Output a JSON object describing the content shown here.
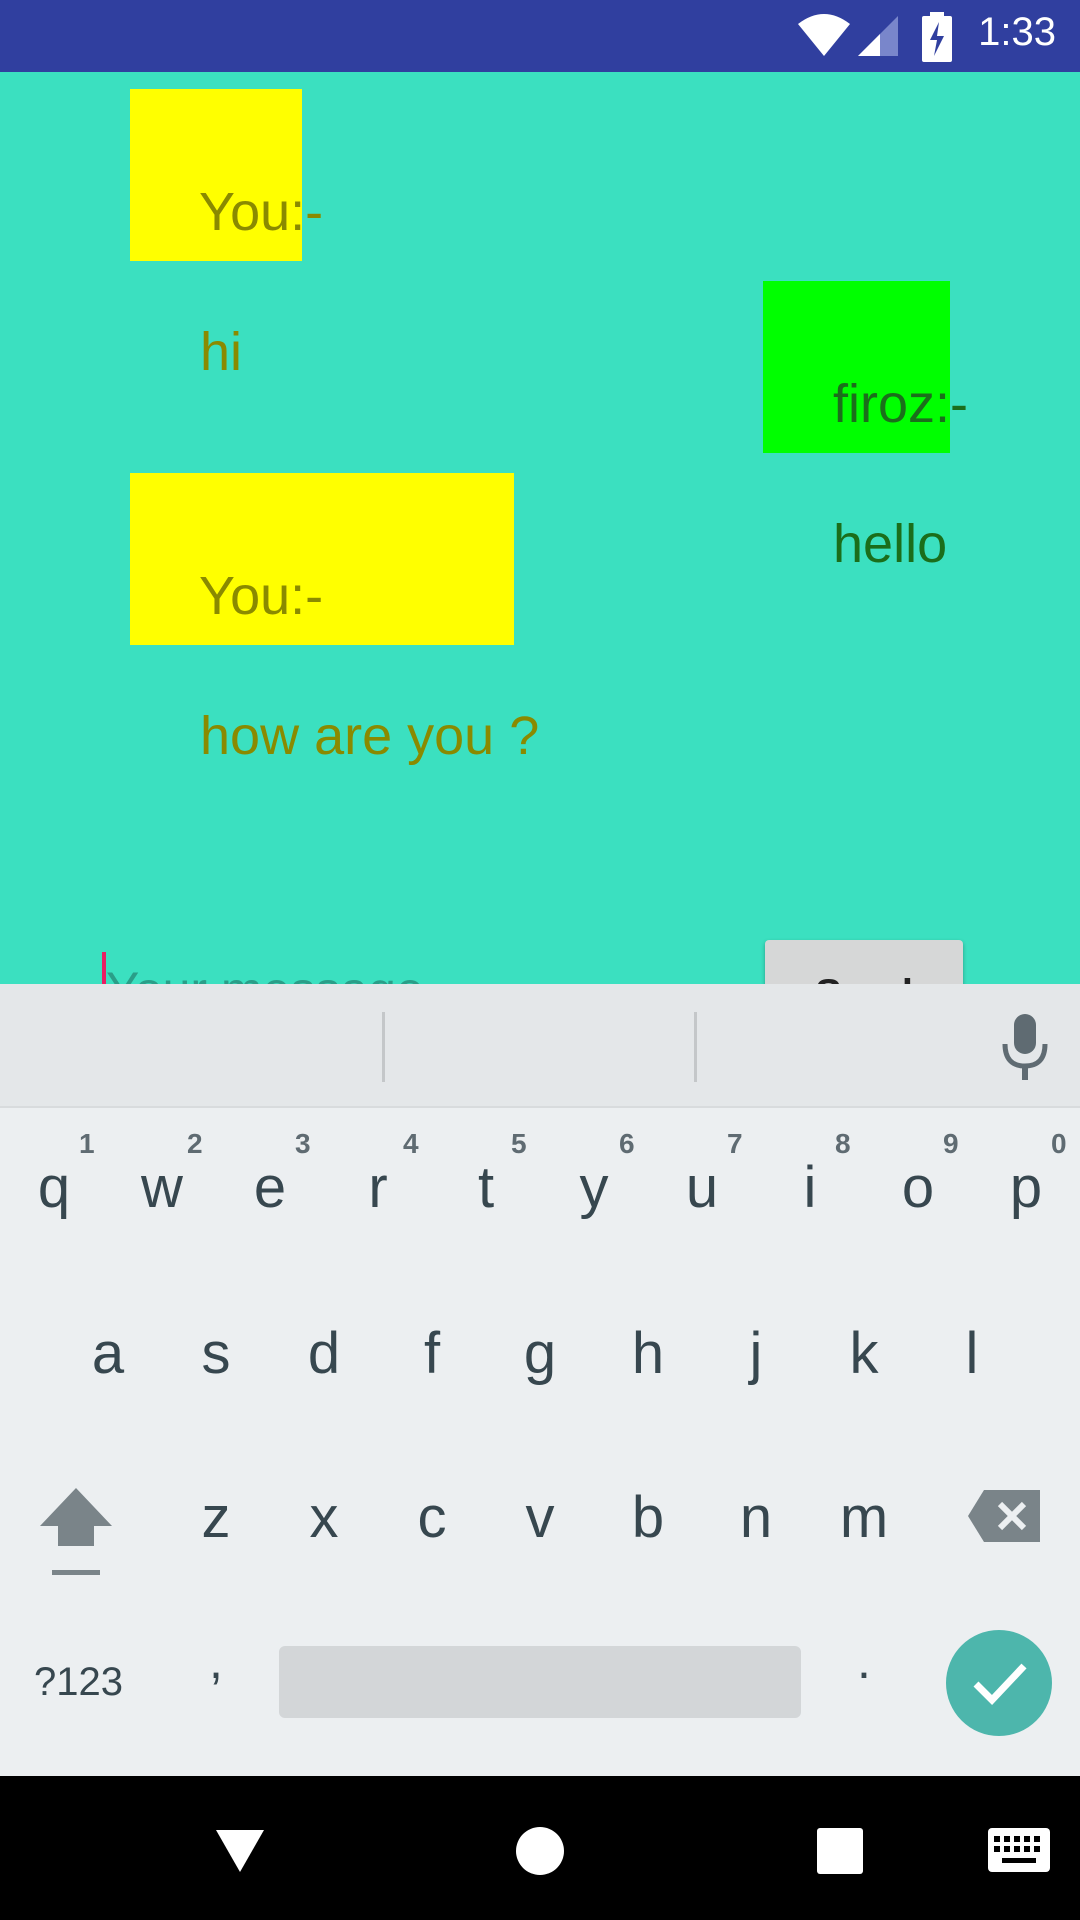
{
  "status_bar": {
    "time": "1:33",
    "icons": [
      "wifi-icon",
      "cell-signal-icon",
      "battery-charging-icon"
    ]
  },
  "chat": {
    "background": "#3BE0C0",
    "messages": [
      {
        "sender": "You:-",
        "text": "hi",
        "side": "left",
        "color": "#FFFF00"
      },
      {
        "sender": "firoz:-",
        "text": "hello",
        "side": "right",
        "color": "#00FF00"
      },
      {
        "sender": "You:-",
        "text": "how are you ?",
        "side": "left",
        "color": "#FFFF00"
      }
    ]
  },
  "composer": {
    "placeholder": "Your message",
    "value": "",
    "send_label": "Send"
  },
  "keyboard": {
    "row1": [
      "q",
      "w",
      "e",
      "r",
      "t",
      "y",
      "u",
      "i",
      "o",
      "p"
    ],
    "row1_hints": [
      "1",
      "2",
      "3",
      "4",
      "5",
      "6",
      "7",
      "8",
      "9",
      "0"
    ],
    "row2": [
      "a",
      "s",
      "d",
      "f",
      "g",
      "h",
      "j",
      "k",
      "l"
    ],
    "row3": [
      "z",
      "x",
      "c",
      "v",
      "b",
      "n",
      "m"
    ],
    "symbols_label": "?123",
    "comma": ",",
    "period": ".",
    "accent": "#4DB6AC"
  },
  "nav_bar": {
    "icons": [
      "back-icon",
      "home-icon",
      "recents-icon",
      "keyboard-switch-icon"
    ]
  }
}
